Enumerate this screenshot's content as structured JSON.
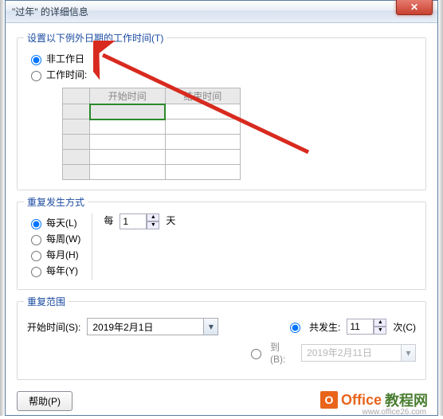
{
  "window": {
    "title": "\"过年\" 的详细信息"
  },
  "close": {
    "label": "✕"
  },
  "group1": {
    "title": "设置以下例外日期的工作时间(T)",
    "opt_nonworking": "非工作日",
    "opt_working": "工作时间:",
    "col_start": "开始时间",
    "col_end": "结束时间"
  },
  "pattern": {
    "title": "重复发生方式",
    "daily": "每天(L)",
    "weekly": "每周(W)",
    "monthly": "每月(H)",
    "yearly": "每年(Y)",
    "every": "每",
    "interval": "1",
    "days": "天"
  },
  "range": {
    "title": "重复范围",
    "start_label": "开始时间(S):",
    "start_value": "2019年2月1日",
    "occur_label": "共发生:",
    "occur_value": "11",
    "occur_suffix": "次(C)",
    "until_label": "到(B):",
    "until_value": "2019年2月11日"
  },
  "buttons": {
    "help": "帮助(P)"
  },
  "watermark": {
    "brand1": "Office",
    "brand2": "教程网",
    "url": "www.office26.com"
  }
}
